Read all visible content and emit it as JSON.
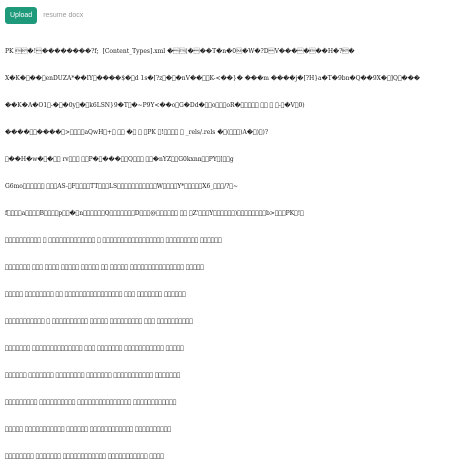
{
  "toolbar": {
    "upload_label": "Upload",
    "file_placeholder": "resume docx"
  },
  "content": {
    "lines": [
      "PK \u0003\u0004�!\u0000��������?f;  [Content_Types].xml �\u0000\u0002(�\u0000��T�n�0\u0010�W�?D\u0000V���\u0000�\u0003��H�?\u0004�",
      "X�K�\u0000��\u0000enDUZA*��IY\u0000����$�\u0000d 1s�[?z\u0000�\u0000�nV��\u0000\u0000K-<��}� ���m ����j�[?H}a�T�9bn�Q��9X�\u0000]Q\u0000���",
      "��K�A�O1\u0000-�\u0000�0y\u0000�\u0000k6LSN}9�T\u0000�~P9Y<��o\u0000G�Dd�\u0000\u0000o\u0000\u0000\u0000oR�\u0000\u0000\u0000\u0000\u0000 \u0000\u0000 \u0000 \u0000-\u0000�V\u00000)",
      "����\u0000\u0000����\u0000>\u0000\u0000\u0000\u0000aQwH\u0000+\u0000 \u0000\u0000 �\u0000 \u0000 \u0000PK \u0000!\u0000\u0000\u0000\u0000 \u0000 _rels/.rels �\u0000(\u0000\u0000\u0000)A�\u0000)\u0000)?",
      "\u0000��H�w�\u0000�\u0000\u0000 rv\u0000\u0000\u0000 \u0000\u0000P�\u0000���\u0000\u0000Q\u0000\u0000\u0000 \u0000\u0000�nYZ\u0000\u0000G0kxnn\u0000\u0000PY\u0000[\u0000\u0000g",
      "G6mo\u0000\u0000\u0000\u0000\u0000\u0000 \u0000\u0000\u0000AS-\u0000F\u0000\u0000\u0000\u0000TT\u0000\u0000\u0000LS\u0000\u0000\u0000\u0000\u0000\u0000\u0000\u0000\u0000\u0000\u0000W\u0000\u0000\u0000\u0000Y*\u0000\u0000\u0000\u0000\u0000X6_\u0000\u0000\u0000/?\u0000~",
      "f\u0000\u0000\u0000\u0000a\u0000\u0000\u0000\u0000B\u0000\u0000\u0000\u0000p\u0000\u0000�\u0000n\u0000\u0000\u0000\u0000\u0000\u0000Q\u0000\u0000\u0000\u0000\u0000\u0000\u0000D\u0000\u0000\u0000@\u0000\u0000\u0000\u0000\u0000\u0000 \u0000\u0000 \u0000Z'\u0000\u0000\u0000Y\u0000\u0000\u0000\u0000\u0000\u0000)\u0000\u0000\u0000\u0000\u0000\u0000\u0000\u0000b>\u0000\u0000\u0000PK\u0000!\u0000",
      "\u0000\u0000\u0000\u0000\u0000\u0000\u0000\u0000\u0000\u0000 \u0000 \u0000\u0000\u0000\u0000\u0000\u0000\u0000\u0000\u0000\u0000\u0000\u0000\u0000 \u0000 \u0000\u0000\u0000\u0000\u0000\u0000\u0000\u0000\u0000\u0000\u0000\u0000\u0000\u0000\u0000\u0000\u0000 \u0000\u0000\u0000\u0000\u0000\u0000\u0000\u0000\u0000 \u0000\u0000\u0000\u0000\u0000\u0000",
      "\u0000\u0000\u0000\u0000\u0000\u0000\u0000 \u0000\u0000\u0000 \u0000\u0000\u0000\u0000 \u0000\u0000\u0000\u0000\u0000 \u0000\u0000\u0000\u0000\u0000 \u0000\u0000 \u0000\u0000\u0000\u0000\u0000 \u0000\u0000\u0000\u0000\u0000\u0000\u0000\u0000\u0000\u0000\u0000\u0000\u0000\u0000\u0000 \u0000\u0000\u0000\u0000\u0000",
      "\u0000\u0000\u0000\u0000\u0000 \u0000\u0000\u0000\u0000\u0000\u0000\u0000\u0000 \u0000\u0000 \u0000\u0000\u0000\u0000\u0000\u0000\u0000\u0000\u0000\u0000\u0000\u0000\u0000\u0000\u0000\u0000 \u0000\u0000\u0000 \u0000\u0000\u0000\u0000\u0000\u0000\u0000 \u0000\u0000\u0000\u0000\u0000\u0000",
      "\u0000\u0000\u0000\u0000\u0000\u0000\u0000\u0000\u0000\u0000\u0000 \u0000 \u0000\u0000\u0000\u0000\u0000\u0000\u0000\u0000\u0000\u0000 \u0000\u0000\u0000\u0000\u0000 \u0000\u0000\u0000\u0000\u0000\u0000\u0000\u0000\u0000 \u0000\u0000\u0000 \u0000\u0000\u0000\u0000\u0000\u0000\u0000\u0000\u0000\u0000",
      "\u0000\u0000\u0000\u0000\u0000\u0000\u0000 \u0000\u0000\u0000\u0000\u0000\u0000\u0000\u0000\u0000\u0000\u0000\u0000\u0000\u0000 \u0000\u0000\u0000 \u0000\u0000\u0000\u0000\u0000\u0000\u0000 \u0000\u0000\u0000\u0000\u0000\u0000\u0000\u0000\u0000\u0000\u0000 \u0000\u0000\u0000\u0000\u0000",
      "\u0000\u0000\u0000\u0000\u0000\u0000 \u0000\u0000\u0000\u0000\u0000\u0000\u0000 \u0000\u0000\u0000\u0000\u0000\u0000\u0000\u0000 \u0000\u0000\u0000\u0000\u0000\u0000\u0000 \u0000\u0000\u0000\u0000\u0000\u0000\u0000\u0000\u0000\u0000\u0000 \u0000\u0000\u0000\u0000\u0000\u0000\u0000",
      "\u0000\u0000\u0000\u0000\u0000\u0000\u0000\u0000\u0000 \u0000\u0000\u0000\u0000\u0000\u0000\u0000\u0000\u0000\u0000 \u0000\u0000\u0000\u0000\u0000\u0000\u0000\u0000\u0000\u0000\u0000\u0000\u0000\u0000\u0000 \u0000\u0000\u0000\u0000\u0000\u0000\u0000\u0000\u0000\u0000\u0000\u0000",
      "\u0000\u0000\u0000\u0000\u0000 \u0000\u0000\u0000\u0000\u0000\u0000\u0000\u0000\u0000\u0000\u0000 \u0000\u0000\u0000\u0000\u0000\u0000 \u0000\u0000\u0000\u0000\u0000\u0000\u0000\u0000\u0000\u0000\u0000\u0000 \u0000\u0000\u0000\u0000\u0000\u0000\u0000\u0000\u0000\u0000",
      "\u0000\u0000\u0000\u0000\u0000\u0000\u0000\u0000 \u0000\u0000\u0000\u0000\u0000\u0000\u0000 \u0000\u0000\u0000\u0000\u0000\u0000\u0000\u0000\u0000\u0000\u0000\u0000 \u0000\u0000\u0000\u0000\u0000\u0000\u0000\u0000\u0000\u0000\u0000 \u0000\u0000\u0000\u0000"
    ]
  }
}
